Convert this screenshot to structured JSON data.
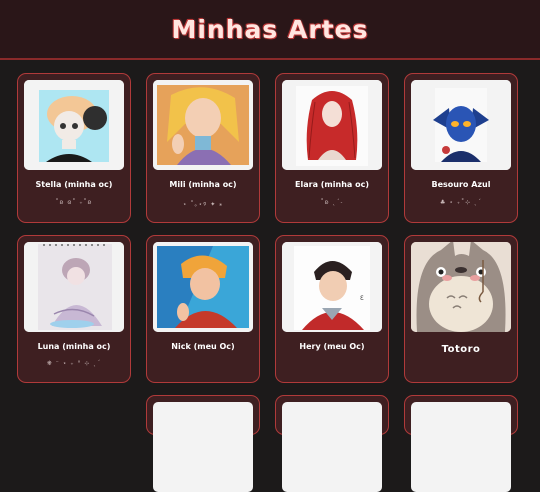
{
  "page": {
    "title": "Minhas Artes"
  },
  "gallery": {
    "items": [
      {
        "name": "Stella (minha oc)",
        "deco": "˚ʚ ɞ˚ ₊˚ʚ"
      },
      {
        "name": "Mili (minha oc)",
        "deco": "⋆ ˚｡⋆୨ ✦ ⁎"
      },
      {
        "name": "Elara (minha oc)",
        "deco": "˚ʚ ˎˊ˗"
      },
      {
        "name": "Besouro Azul",
        "deco": "♣ ⋆ ₊˚⊹ ˎˊ"
      },
      {
        "name": "Luna (minha oc)",
        "deco": "❋ ⁻ ⋆ ₊ ° ⊹ ˎˊ"
      },
      {
        "name": "Nick (meu Oc)",
        "deco": ""
      },
      {
        "name": "Hery (meu Oc)",
        "deco": ""
      },
      {
        "name": "Totoro",
        "deco": ""
      }
    ]
  }
}
